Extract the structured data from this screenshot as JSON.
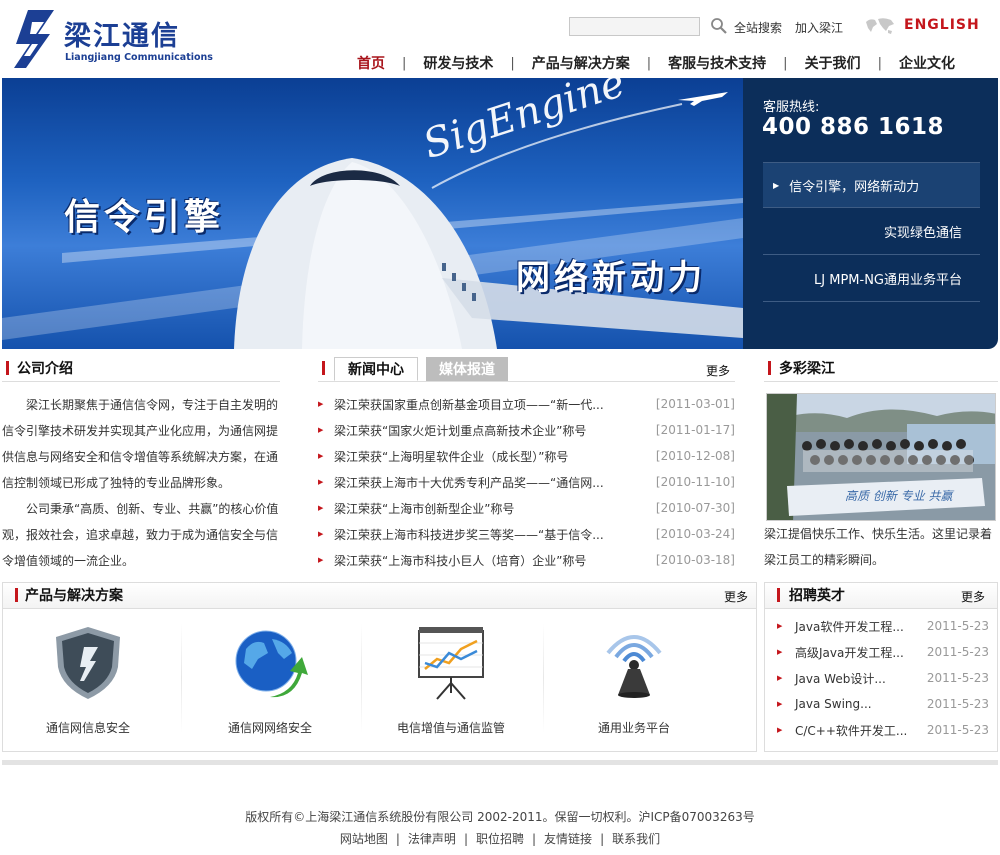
{
  "header": {
    "logo_cn": "梁江通信",
    "logo_en": "Liangjiang Communications",
    "search_label": "全站搜索",
    "join_label": "加入梁江",
    "english_label": "ENGLISH",
    "nav": [
      {
        "label": "首页",
        "active": true
      },
      {
        "label": "研发与技术"
      },
      {
        "label": "产品与解决方案"
      },
      {
        "label": "客服与技术支持"
      },
      {
        "label": "关于我们"
      },
      {
        "label": "企业文化"
      }
    ],
    "nav_separator": "|"
  },
  "banner": {
    "title_left": "信令引擎",
    "title_right": "网络新动力",
    "script_text": "SigEngine",
    "hotline_label": "客服热线:",
    "hotline_number": "400 886 1618",
    "slogans": [
      "信令引擎，网络新动力",
      "实现绿色通信",
      "LJ MPM-NG通用业务平台"
    ]
  },
  "about": {
    "title": "公司介绍",
    "paragraphs": [
      "梁江长期聚焦于通信信令网，专注于自主发明的信令引擎技术研发并实现其产业化应用，为通信网提供信息与网络安全和信令增值等系统解决方案，在通信控制领域已形成了独特的专业品牌形象。",
      "公司秉承“高质、创新、专业、共赢”的核心价值观，报效社会，追求卓越，致力于成为通信安全与信令增值领域的一流企业。"
    ]
  },
  "news": {
    "tabs": [
      "新闻中心",
      "媒体报道"
    ],
    "more": "更多",
    "items": [
      {
        "title": "梁江荣获国家重点创新基金项目立项——“新一代...",
        "date": "[2011-03-01]"
      },
      {
        "title": "梁江荣获“国家火炬计划重点高新技术企业”称号",
        "date": "[2011-01-17]"
      },
      {
        "title": "梁江荣获“上海明星软件企业（成长型）”称号",
        "date": "[2010-12-08]"
      },
      {
        "title": "梁江荣获上海市十大优秀专利产品奖——“通信网...",
        "date": "[2010-11-10]"
      },
      {
        "title": "梁江荣获“上海市创新型企业”称号",
        "date": "[2010-07-30]"
      },
      {
        "title": "梁江荣获上海市科技进步奖三等奖——“基于信令...",
        "date": "[2010-03-24]"
      },
      {
        "title": "梁江荣获“上海市科技小巨人（培育）企业”称号",
        "date": "[2010-03-18]"
      }
    ]
  },
  "colorful": {
    "title": "多彩梁江",
    "banner_text": "高质 创新 专业 共赢",
    "text": "梁江提倡快乐工作、快乐生活。这里记录着梁江员工的精彩瞬间。"
  },
  "products": {
    "title": "产品与解决方案",
    "more": "更多",
    "items": [
      {
        "name": "通信网信息安全",
        "icon": "shield-icon"
      },
      {
        "name": "通信网网络安全",
        "icon": "globe-arrow-icon"
      },
      {
        "name": "电信增值与通信监管",
        "icon": "chart-board-icon"
      },
      {
        "name": "通用业务平台",
        "icon": "signal-tower-icon"
      }
    ]
  },
  "jobs": {
    "title": "招聘英才",
    "more": "更多",
    "items": [
      {
        "title": "Java软件开发工程...",
        "date": "2011-5-23"
      },
      {
        "title": "高级Java开发工程...",
        "date": "2011-5-23"
      },
      {
        "title": "Java Web设计...",
        "date": "2011-5-23"
      },
      {
        "title": "Java Swing...",
        "date": "2011-5-23"
      },
      {
        "title": "C/C++软件开发工...",
        "date": "2011-5-23"
      }
    ]
  },
  "footer": {
    "copyright": "版权所有©上海梁江通信系统股份有限公司  2002-2011。保留一切权利。沪ICP备07003263号",
    "links": [
      "网站地图",
      "法律声明",
      "职位招聘",
      "友情链接",
      "联系我们"
    ]
  },
  "colors": {
    "brand_blue": "#1c3f94",
    "accent_red": "#c4161c",
    "side_panel": "#0c2e5a"
  }
}
